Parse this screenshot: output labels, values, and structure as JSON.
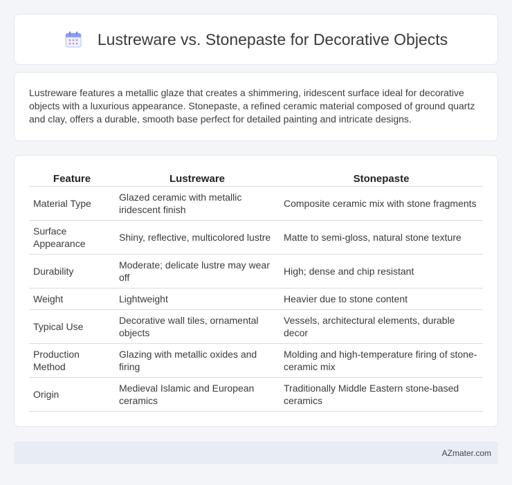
{
  "header": {
    "title": "Lustreware vs. Stonepaste for Decorative Objects",
    "icon": "calendar-icon",
    "accent": "#7b8ff0"
  },
  "intro": {
    "text": "Lustreware features a metallic glaze that creates a shimmering, iridescent surface ideal for decorative objects with a luxurious appearance. Stonepaste, a refined ceramic material composed of ground quartz and clay, offers a durable, smooth base perfect for detailed painting and intricate designs."
  },
  "table": {
    "headers": [
      "Feature",
      "Lustreware",
      "Stonepaste"
    ],
    "rows": [
      [
        "Material Type",
        "Glazed ceramic with metallic iridescent finish",
        "Composite ceramic mix with stone fragments"
      ],
      [
        "Surface Appearance",
        "Shiny, reflective, multicolored lustre",
        "Matte to semi-gloss, natural stone texture"
      ],
      [
        "Durability",
        "Moderate; delicate lustre may wear off",
        "High; dense and chip resistant"
      ],
      [
        "Weight",
        "Lightweight",
        "Heavier due to stone content"
      ],
      [
        "Typical Use",
        "Decorative wall tiles, ornamental objects",
        "Vessels, architectural elements, durable decor"
      ],
      [
        "Production Method",
        "Glazing with metallic oxides and firing",
        "Molding and high-temperature firing of stone-ceramic mix"
      ],
      [
        "Origin",
        "Medieval Islamic and European ceramics",
        "Traditionally Middle Eastern stone-based ceramics"
      ]
    ]
  },
  "footer": {
    "brand": "AZmater.com"
  }
}
